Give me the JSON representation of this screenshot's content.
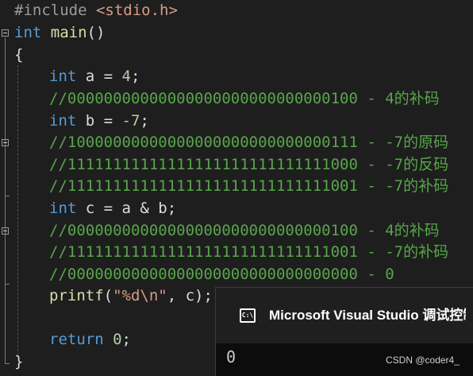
{
  "code": {
    "include": {
      "directive": "#include",
      "header": "<stdio.h>"
    },
    "main_sig": {
      "type": "int",
      "name": "main",
      "parens": "()"
    },
    "open_brace": "{",
    "decl_a": {
      "type": "int",
      "rest": " a = ",
      "value": "4",
      "end": ";"
    },
    "comment_a_comp": "//00000000000000000000000000000100 - 4的补码",
    "decl_b": {
      "type": "int",
      "rest": " b = ",
      "value": "-7",
      "end": ";"
    },
    "comment_b_orig": "//10000000000000000000000000000111 - -7的原码",
    "comment_b_inv": "//11111111111111111111111111111000 - -7的反码",
    "comment_b_comp": "//11111111111111111111111111111001 - -7的补码",
    "decl_c": {
      "type": "int",
      "rest": " c = a & b;"
    },
    "comment_c1": "//00000000000000000000000000000100 - 4的补码",
    "comment_c2": "//11111111111111111111111111111001 - -7的补码",
    "comment_c3": "//00000000000000000000000000000000 - 0",
    "printf": {
      "fn": "printf",
      "open": "(",
      "fmt": "\"%d\\n\"",
      "rest": ", c);"
    },
    "ret": {
      "kw": "return",
      "value": "0",
      "end": ";"
    },
    "close_brace": "}"
  },
  "console": {
    "icon": "console-app-icon",
    "icon_text": "C:\\",
    "title": "Microsoft Visual Studio 调试控制台",
    "output": "0"
  },
  "watermark": "CSDN @coder4_"
}
